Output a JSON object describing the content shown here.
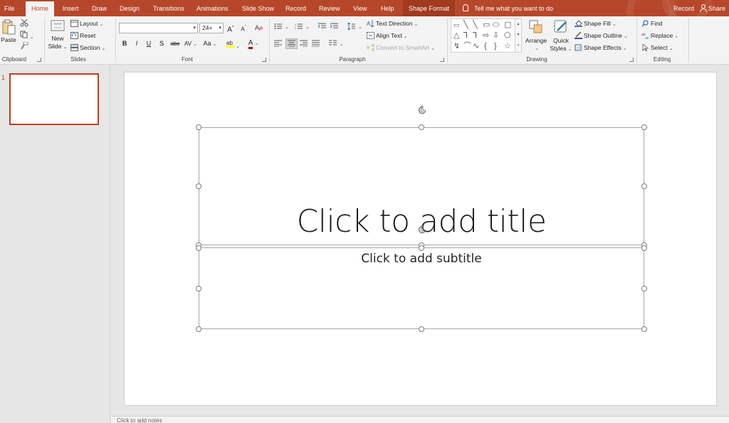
{
  "tabs": {
    "file": "File",
    "home": "Home",
    "insert": "Insert",
    "draw": "Draw",
    "design": "Design",
    "transitions": "Transitions",
    "animations": "Animations",
    "slide_show": "Slide Show",
    "record": "Record",
    "review": "Review",
    "view": "View",
    "help": "Help",
    "shape_format": "Shape Format"
  },
  "tell_me": "Tell me what you want to do",
  "record_button": "Record",
  "share_button": "Share",
  "clipboard": {
    "label": "Clipboard",
    "paste": "Paste"
  },
  "slides_group": {
    "label": "Slides",
    "new_slide_line1": "New",
    "new_slide_line2": "Slide",
    "layout": "Layout",
    "reset": "Reset",
    "section": "Section"
  },
  "font_group": {
    "label": "Font",
    "font_name": "",
    "font_size": "24+",
    "bold": "B",
    "italic": "I",
    "underline": "U",
    "shadow": "S",
    "strike": "abc",
    "spacing": "AV",
    "case": "Aa",
    "grow": "A",
    "shrink": "A",
    "font_color": "A"
  },
  "paragraph_group": {
    "label": "Paragraph",
    "text_direction": "Text Direction",
    "align_text": "Align Text",
    "convert_smartart": "Convert to SmartArt"
  },
  "drawing_group": {
    "label": "Drawing",
    "arrange": "Arrange",
    "quick_styles_line1": "Quick",
    "quick_styles_line2": "Styles",
    "shape_fill": "Shape Fill",
    "shape_outline": "Shape Outline",
    "shape_effects": "Shape Effects"
  },
  "editing_group": {
    "label": "Editing",
    "find": "Find",
    "replace": "Replace",
    "select": "Select"
  },
  "thumbnail": {
    "number": "1"
  },
  "slide": {
    "title_placeholder": "Click to add title",
    "subtitle_placeholder": "Click to add subtitle"
  },
  "notes": "Click to add notes",
  "colors": {
    "accent": "#b7472a",
    "ribbon_bg": "#f3f3f3",
    "canvas_bg": "#e6e6e6"
  }
}
